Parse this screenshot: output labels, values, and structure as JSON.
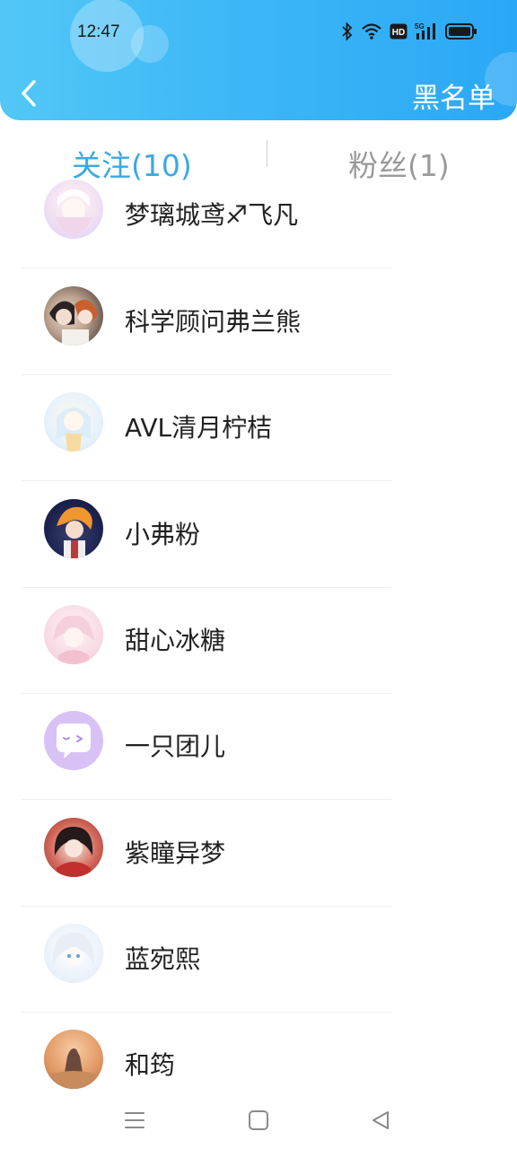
{
  "status_bar": {
    "time": "12:47",
    "icons": [
      "bluetooth-icon",
      "wifi-icon",
      "hd-icon",
      "5g-signal-icon",
      "battery-icon"
    ]
  },
  "header": {
    "back_icon": "chevron-left-icon",
    "right_action": "黑名单"
  },
  "tabs": [
    {
      "label": "关注(10)",
      "active": true
    },
    {
      "label": "粉丝(1)",
      "active": false
    }
  ],
  "users": [
    {
      "name": "梦璃城鸢♐飞凡",
      "avatar": "anime-girl-white"
    },
    {
      "name": "科学顾问弗兰熊",
      "avatar": "anime-boys-dark"
    },
    {
      "name": "AVL清月柠桔",
      "avatar": "anime-girl-blue"
    },
    {
      "name": "小弗粉",
      "avatar": "anime-boy-orange"
    },
    {
      "name": "甜心冰糖",
      "avatar": "anime-girl-pink"
    },
    {
      "name": "一只团儿",
      "avatar": "purple-chat-bubble-icon"
    },
    {
      "name": "紫瞳异梦",
      "avatar": "anime-girl-red"
    },
    {
      "name": "蓝宛熙",
      "avatar": "anime-girl-silver"
    },
    {
      "name": "和筠",
      "avatar": "landscape-orange"
    }
  ],
  "navbar": {
    "icons": [
      "menu-icon",
      "home-square-icon",
      "back-triangle-icon"
    ]
  },
  "colors": {
    "header_start": "#52c7f7",
    "header_end": "#2aa8f6",
    "active_tab": "#3aa8e4",
    "inactive_tab": "#9a9a9a"
  }
}
